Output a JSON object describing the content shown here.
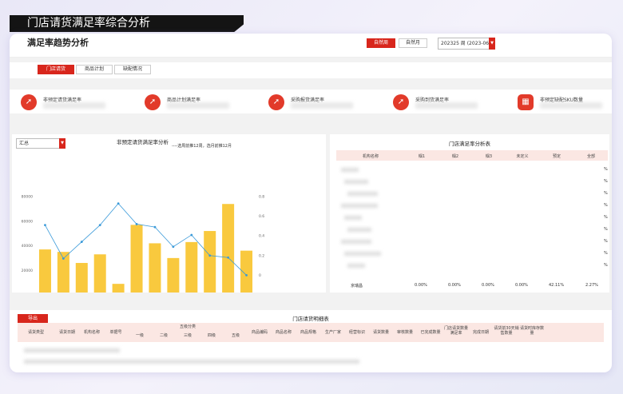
{
  "banner": {
    "title": "门店请货满足率综合分析"
  },
  "header": {
    "title": "满足率趋势分析",
    "btn_week": "自然周",
    "btn_month": "自然月",
    "period_select": "202325 周 (2023-06..."
  },
  "tabs": [
    "门店请货",
    "商品计划",
    "缺配情况"
  ],
  "kpis": [
    {
      "label": "非预定请货满足率",
      "icon": "trend-up-icon"
    },
    {
      "label": "商品计划满足率",
      "icon": "trend-up-icon"
    },
    {
      "label": "采购报货满足率",
      "icon": "trend-up-icon"
    },
    {
      "label": "采购到货满足率",
      "icon": "trend-up-icon"
    },
    {
      "label": "非预定缺配SKU数量",
      "icon": "calendar-icon"
    }
  ],
  "chart_panel": {
    "select_value": "汇总",
    "title": "非预定请货满足率分析",
    "note": "----选周前推12周，选月前推12月",
    "legend_bar": "请货数量",
    "legend_line": "满足率"
  },
  "chart_data": {
    "type": "bar",
    "categories": [
      "202314",
      "202315",
      "202316",
      "202317",
      "202318",
      "202319",
      "202320",
      "202321",
      "202322",
      "202323",
      "202324",
      "202325"
    ],
    "series": [
      {
        "name": "请货数量",
        "type": "bar",
        "axis": "left",
        "values": [
          37000,
          35000,
          26000,
          33000,
          9000,
          57000,
          42000,
          30000,
          43000,
          52000,
          74000,
          36000
        ]
      },
      {
        "name": "满足率",
        "type": "line",
        "axis": "right",
        "values": [
          0.51,
          0.17,
          0.34,
          0.51,
          0.73,
          0.52,
          0.49,
          0.29,
          0.41,
          0.2,
          0.18,
          0.0
        ]
      }
    ],
    "yleft_ticks": [
      "0",
      "20000",
      "40000",
      "60000",
      "80000"
    ],
    "yright_ticks": [
      "-0.2",
      "0",
      "0.2",
      "0.4",
      "0.6",
      "0.8"
    ],
    "ylim_left": [
      0,
      80000
    ],
    "ylim_right": [
      -0.2,
      0.8
    ],
    "colors": {
      "bar": "#f9c93e",
      "line": "#3a9ad9"
    }
  },
  "store_table": {
    "title": "门店满足率分析表",
    "headers": [
      "机构名称",
      "帼1",
      "帼2",
      "帼3",
      "未定义",
      "预定",
      "全部"
    ],
    "partial_col": [
      "%",
      "%",
      "%",
      "%",
      "%",
      "%",
      "%",
      "%",
      "%"
    ],
    "last_row": [
      "京瑞昌",
      "0.00%",
      "0.00%",
      "0.00%",
      "0.00%",
      "42.11%",
      "2.27%"
    ]
  },
  "detail": {
    "export_label": "导出",
    "title": "门店请货明细表",
    "headers": [
      "请货类型",
      "请货日期",
      "机构名称",
      "单据号",
      "商品编码",
      "商品名称",
      "商品规格",
      "生产厂家",
      "经营标识",
      "请货数量",
      "审核数量",
      "已完成数量",
      "门店请货数量满足率",
      "完成日期",
      "请货前30天销售数量",
      "请货时库存数量",
      "请货时总部库存数量"
    ],
    "group_header": "五级分类",
    "group_sub": [
      "一级",
      "二级",
      "三级",
      "四级",
      "五级"
    ]
  }
}
